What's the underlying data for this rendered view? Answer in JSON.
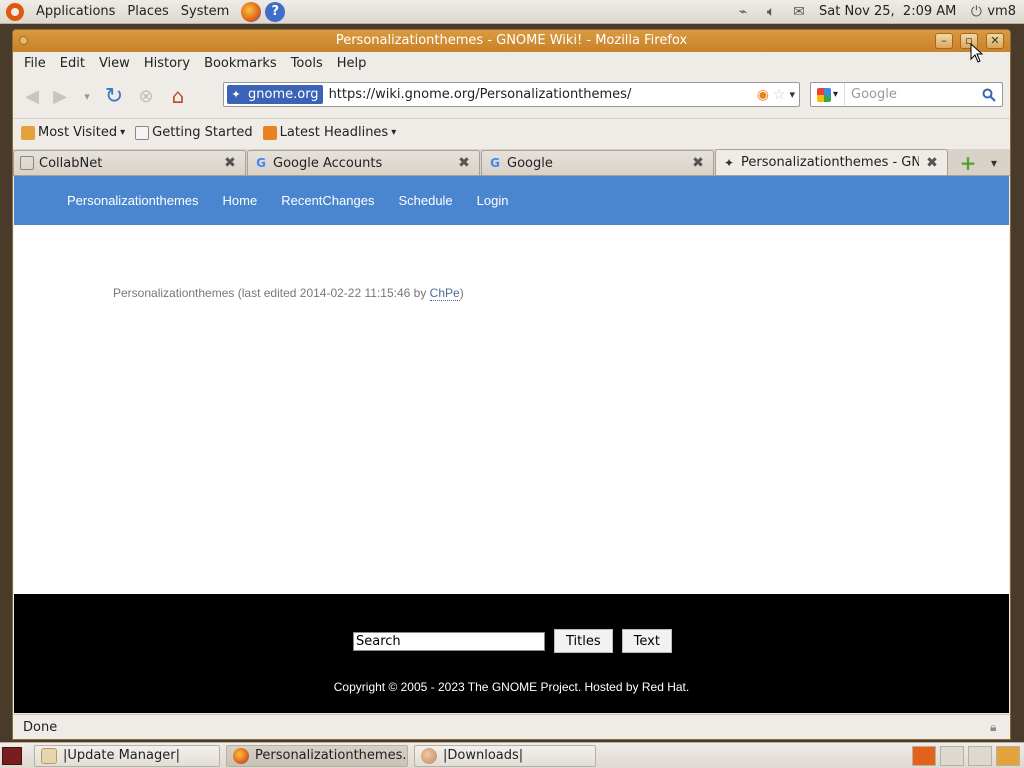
{
  "top_panel": {
    "menus": [
      "Applications",
      "Places",
      "System"
    ],
    "clock": "Sat Nov 25,  2:09 AM",
    "user": "vm8"
  },
  "window": {
    "title": "Personalizationthemes - GNOME Wiki! - Mozilla Firefox",
    "menubar": [
      "File",
      "Edit",
      "View",
      "History",
      "Bookmarks",
      "Tools",
      "Help"
    ]
  },
  "navbar": {
    "site_identity": "gnome.org",
    "url": "https://wiki.gnome.org/Personalizationthemes/",
    "search_placeholder": "Google"
  },
  "bookmarks": {
    "most_visited": "Most  Visited",
    "getting_started": "Getting  Started",
    "latest_headlines": "Latest  Headlines"
  },
  "tabs": [
    {
      "label": "CollabNet"
    },
    {
      "label": "Google  Accounts"
    },
    {
      "label": "Google"
    },
    {
      "label": "Personalizationthemes  -  GN..."
    }
  ],
  "wiki": {
    "nav": [
      "Personalizationthemes",
      "Home",
      "RecentChanges",
      "Schedule",
      "Login"
    ],
    "page_info_prefix": "Personalizationthemes (last edited 2014-02-22 11:15:46 by ",
    "page_info_author": "ChPe",
    "page_info_suffix": ")"
  },
  "footer": {
    "search_value": "Search",
    "titles_button": "Titles",
    "text_button": "Text",
    "copyright": "Copyright © 2005 - 2023 The GNOME Project. Hosted by Red Hat."
  },
  "status": {
    "text": "Done"
  },
  "taskbar": {
    "items": [
      "|Update Manager|",
      "Personalizationthemes...",
      "|Downloads|"
    ]
  },
  "colors": {
    "wiki_nav": "#4a86cf",
    "titlebar": "#d99a3e",
    "footer": "#000000"
  }
}
